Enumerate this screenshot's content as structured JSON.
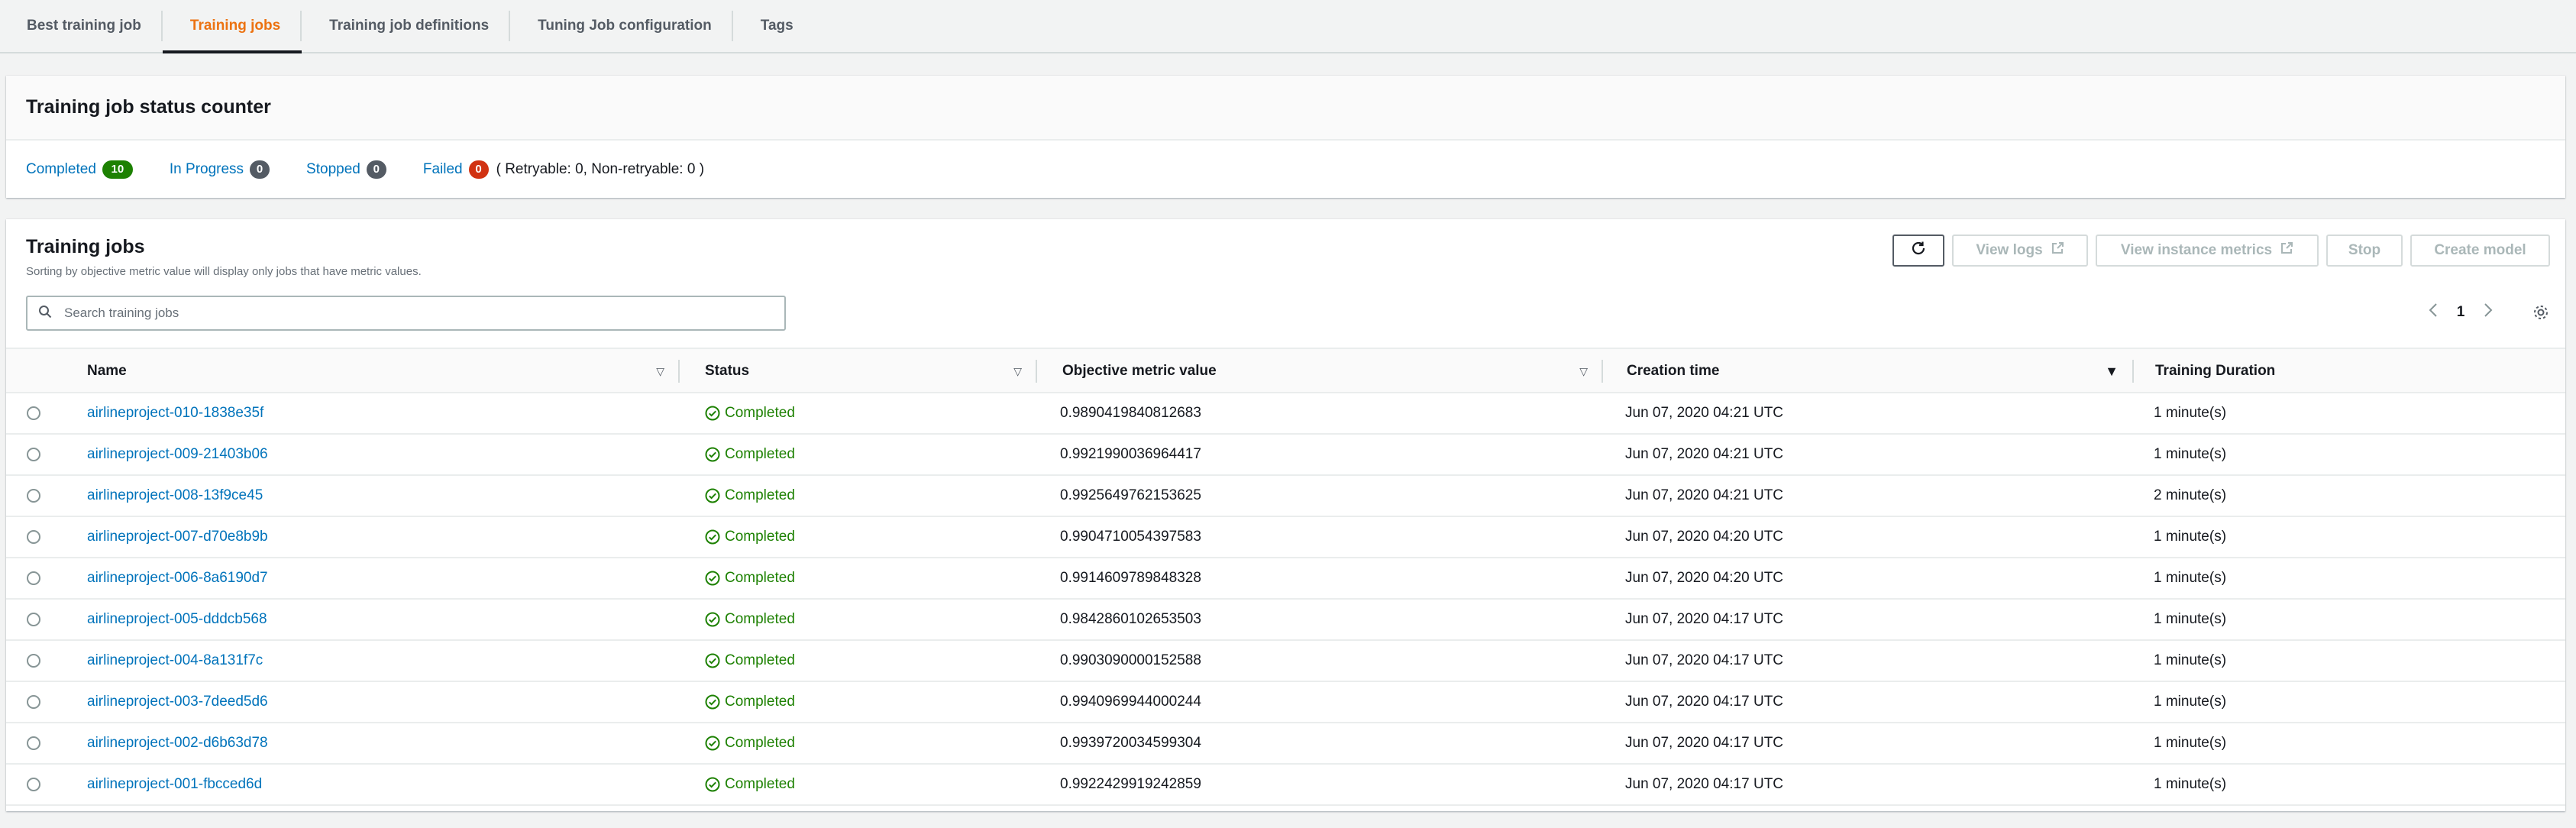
{
  "tabs": [
    {
      "label": "Best training job",
      "active": false
    },
    {
      "label": "Training jobs",
      "active": true
    },
    {
      "label": "Training job definitions",
      "active": false
    },
    {
      "label": "Tuning Job configuration",
      "active": false
    },
    {
      "label": "Tags",
      "active": false
    }
  ],
  "status_counter": {
    "title": "Training job status counter",
    "completed_label": "Completed",
    "completed_count": "10",
    "in_progress_label": "In Progress",
    "in_progress_count": "0",
    "stopped_label": "Stopped",
    "stopped_count": "0",
    "failed_label": "Failed",
    "failed_count": "0",
    "failed_note": "( Retryable: 0, Non-retryable: 0 )"
  },
  "training_jobs": {
    "title": "Training jobs",
    "description": "Sorting by objective metric value will display only jobs that have metric values.",
    "buttons": {
      "view_logs": "View logs",
      "view_metrics": "View instance metrics",
      "stop": "Stop",
      "create_model": "Create model"
    },
    "search_placeholder": "Search training jobs",
    "page": "1",
    "columns": {
      "name": "Name",
      "status": "Status",
      "metric": "Objective metric value",
      "creation_time": "Creation time",
      "duration": "Training Duration"
    },
    "rows": [
      {
        "name": "airlineproject-010-1838e35f",
        "status": "Completed",
        "metric": "0.9890419840812683",
        "time": "Jun 07, 2020 04:21 UTC",
        "duration": "1 minute(s)"
      },
      {
        "name": "airlineproject-009-21403b06",
        "status": "Completed",
        "metric": "0.9921990036964417",
        "time": "Jun 07, 2020 04:21 UTC",
        "duration": "1 minute(s)"
      },
      {
        "name": "airlineproject-008-13f9ce45",
        "status": "Completed",
        "metric": "0.9925649762153625",
        "time": "Jun 07, 2020 04:21 UTC",
        "duration": "2 minute(s)"
      },
      {
        "name": "airlineproject-007-d70e8b9b",
        "status": "Completed",
        "metric": "0.9904710054397583",
        "time": "Jun 07, 2020 04:20 UTC",
        "duration": "1 minute(s)"
      },
      {
        "name": "airlineproject-006-8a6190d7",
        "status": "Completed",
        "metric": "0.9914609789848328",
        "time": "Jun 07, 2020 04:20 UTC",
        "duration": "1 minute(s)"
      },
      {
        "name": "airlineproject-005-dddcb568",
        "status": "Completed",
        "metric": "0.9842860102653503",
        "time": "Jun 07, 2020 04:17 UTC",
        "duration": "1 minute(s)"
      },
      {
        "name": "airlineproject-004-8a131f7c",
        "status": "Completed",
        "metric": "0.9903090000152588",
        "time": "Jun 07, 2020 04:17 UTC",
        "duration": "1 minute(s)"
      },
      {
        "name": "airlineproject-003-7deed5d6",
        "status": "Completed",
        "metric": "0.9940969944000244",
        "time": "Jun 07, 2020 04:17 UTC",
        "duration": "1 minute(s)"
      },
      {
        "name": "airlineproject-002-d6b63d78",
        "status": "Completed",
        "metric": "0.9939720034599304",
        "time": "Jun 07, 2020 04:17 UTC",
        "duration": "1 minute(s)"
      },
      {
        "name": "airlineproject-001-fbcced6d",
        "status": "Completed",
        "metric": "0.9922429919242859",
        "time": "Jun 07, 2020 04:17 UTC",
        "duration": "1 minute(s)"
      }
    ]
  },
  "colors": {
    "link": "#0073bb",
    "active_tab": "#ec7211",
    "success": "#1d8102",
    "failed_badge": "#d13212",
    "neutral_badge": "#545b64"
  }
}
